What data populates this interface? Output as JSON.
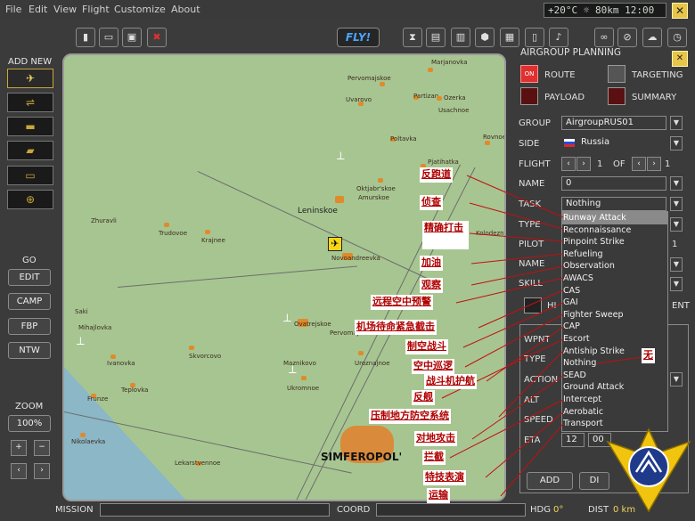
{
  "menu": [
    "File",
    "Edit",
    "View",
    "Flight",
    "Customize",
    "About"
  ],
  "status_readout": "+20°C ☼ 80km 12:00",
  "fly_label": "FLY!",
  "add_new_label": "ADD NEW",
  "go_label": "GO",
  "go_buttons": [
    "EDIT",
    "CAMP",
    "FBP",
    "NTW"
  ],
  "zoom": {
    "label": "ZOOM",
    "value": "100%",
    "plus": "+",
    "minus": "−"
  },
  "panel": {
    "title": "AIRGROUP PLANNING",
    "route": "ROUTE",
    "targeting": "TARGETING",
    "payload": "PAYLOAD",
    "summary": "SUMMARY",
    "on": "ON",
    "group_label": "GROUP",
    "group_value": "AirgroupRUS01",
    "side_label": "SIDE",
    "side_value": "Russia",
    "flight_label": "FLIGHT",
    "flight_value": "1",
    "of_label": "OF",
    "of_value": "1",
    "name_label": "NAME",
    "name_value": "0",
    "task_label": "TASK",
    "task_value": "Nothing",
    "type_label": "TYPE",
    "pilot_label": "PILOT",
    "pilot_value": "1",
    "name2_label": "NAME",
    "skill_label": "SKILL",
    "hi_partial": "HI",
    "ent_partial": "ENT",
    "wpnt_label": "WPNT",
    "type2_label": "TYPE",
    "action_label": "ACTION",
    "alt_label": "ALT",
    "speed_label": "SPEED",
    "eta_label": "ETA",
    "eta_h": "12",
    "eta_m": "00",
    "add_button": "ADD",
    "d_button": "DI"
  },
  "tasks": [
    "Runway Attack",
    "Reconnaissance",
    "Pinpoint Strike",
    "Refueling",
    "Observation",
    "AWACS",
    "CAS",
    "GAI",
    "Fighter Sweep",
    "CAP",
    "Escort",
    "Antiship Strike",
    "Nothing",
    "SEAD",
    "Ground Attack",
    "Intercept",
    "Aerobatic",
    "Transport"
  ],
  "annotations": [
    "反跑道",
    "侦查",
    "精确打击",
    "加油",
    "观察",
    "远程空中预警",
    "机场待命紧急截击",
    "制空战斗",
    "空中巡逻",
    "战斗机护航",
    "反舰",
    "压制地方防空系统",
    "对地攻击",
    "拦截",
    "特技表演",
    "运输",
    "无"
  ],
  "towns": [
    "Marjanovka",
    "Pervomajskoe",
    "Partizan",
    "Uvarovo",
    "Ozerka",
    "Usachnoe",
    "Rovnoe",
    "Poltavka",
    "Pjatihatka",
    "Oktjabr'skoe",
    "Amurskoe",
    "Leninskoe",
    "Zhuravli",
    "Trudovoe",
    "Krajnee",
    "Novoandreevka",
    "Kolodeznoe",
    "Ovatrejskoe",
    "Pervomajskoe",
    "Mihajlovka",
    "Skvorcovo",
    "Ivanovka",
    "Maznikovo",
    "Uroznajnoe",
    "Ukromnoe",
    "Teplovka",
    "Frunze",
    "Nikolaevka",
    "Lekarstvennoe",
    "Saki"
  ],
  "bigcity": "SIMFEROPOL'",
  "bottom": {
    "mission": "MISSION",
    "coord": "COORD",
    "hdg": "HDG",
    "hdg_value": "0°",
    "dist": "DIST",
    "dist_value": "0 km"
  },
  "colors": {
    "map_land": "#a7c591",
    "town": "#e08b2a",
    "accent": "#c9a63a",
    "annotation_text": "#b00000"
  }
}
